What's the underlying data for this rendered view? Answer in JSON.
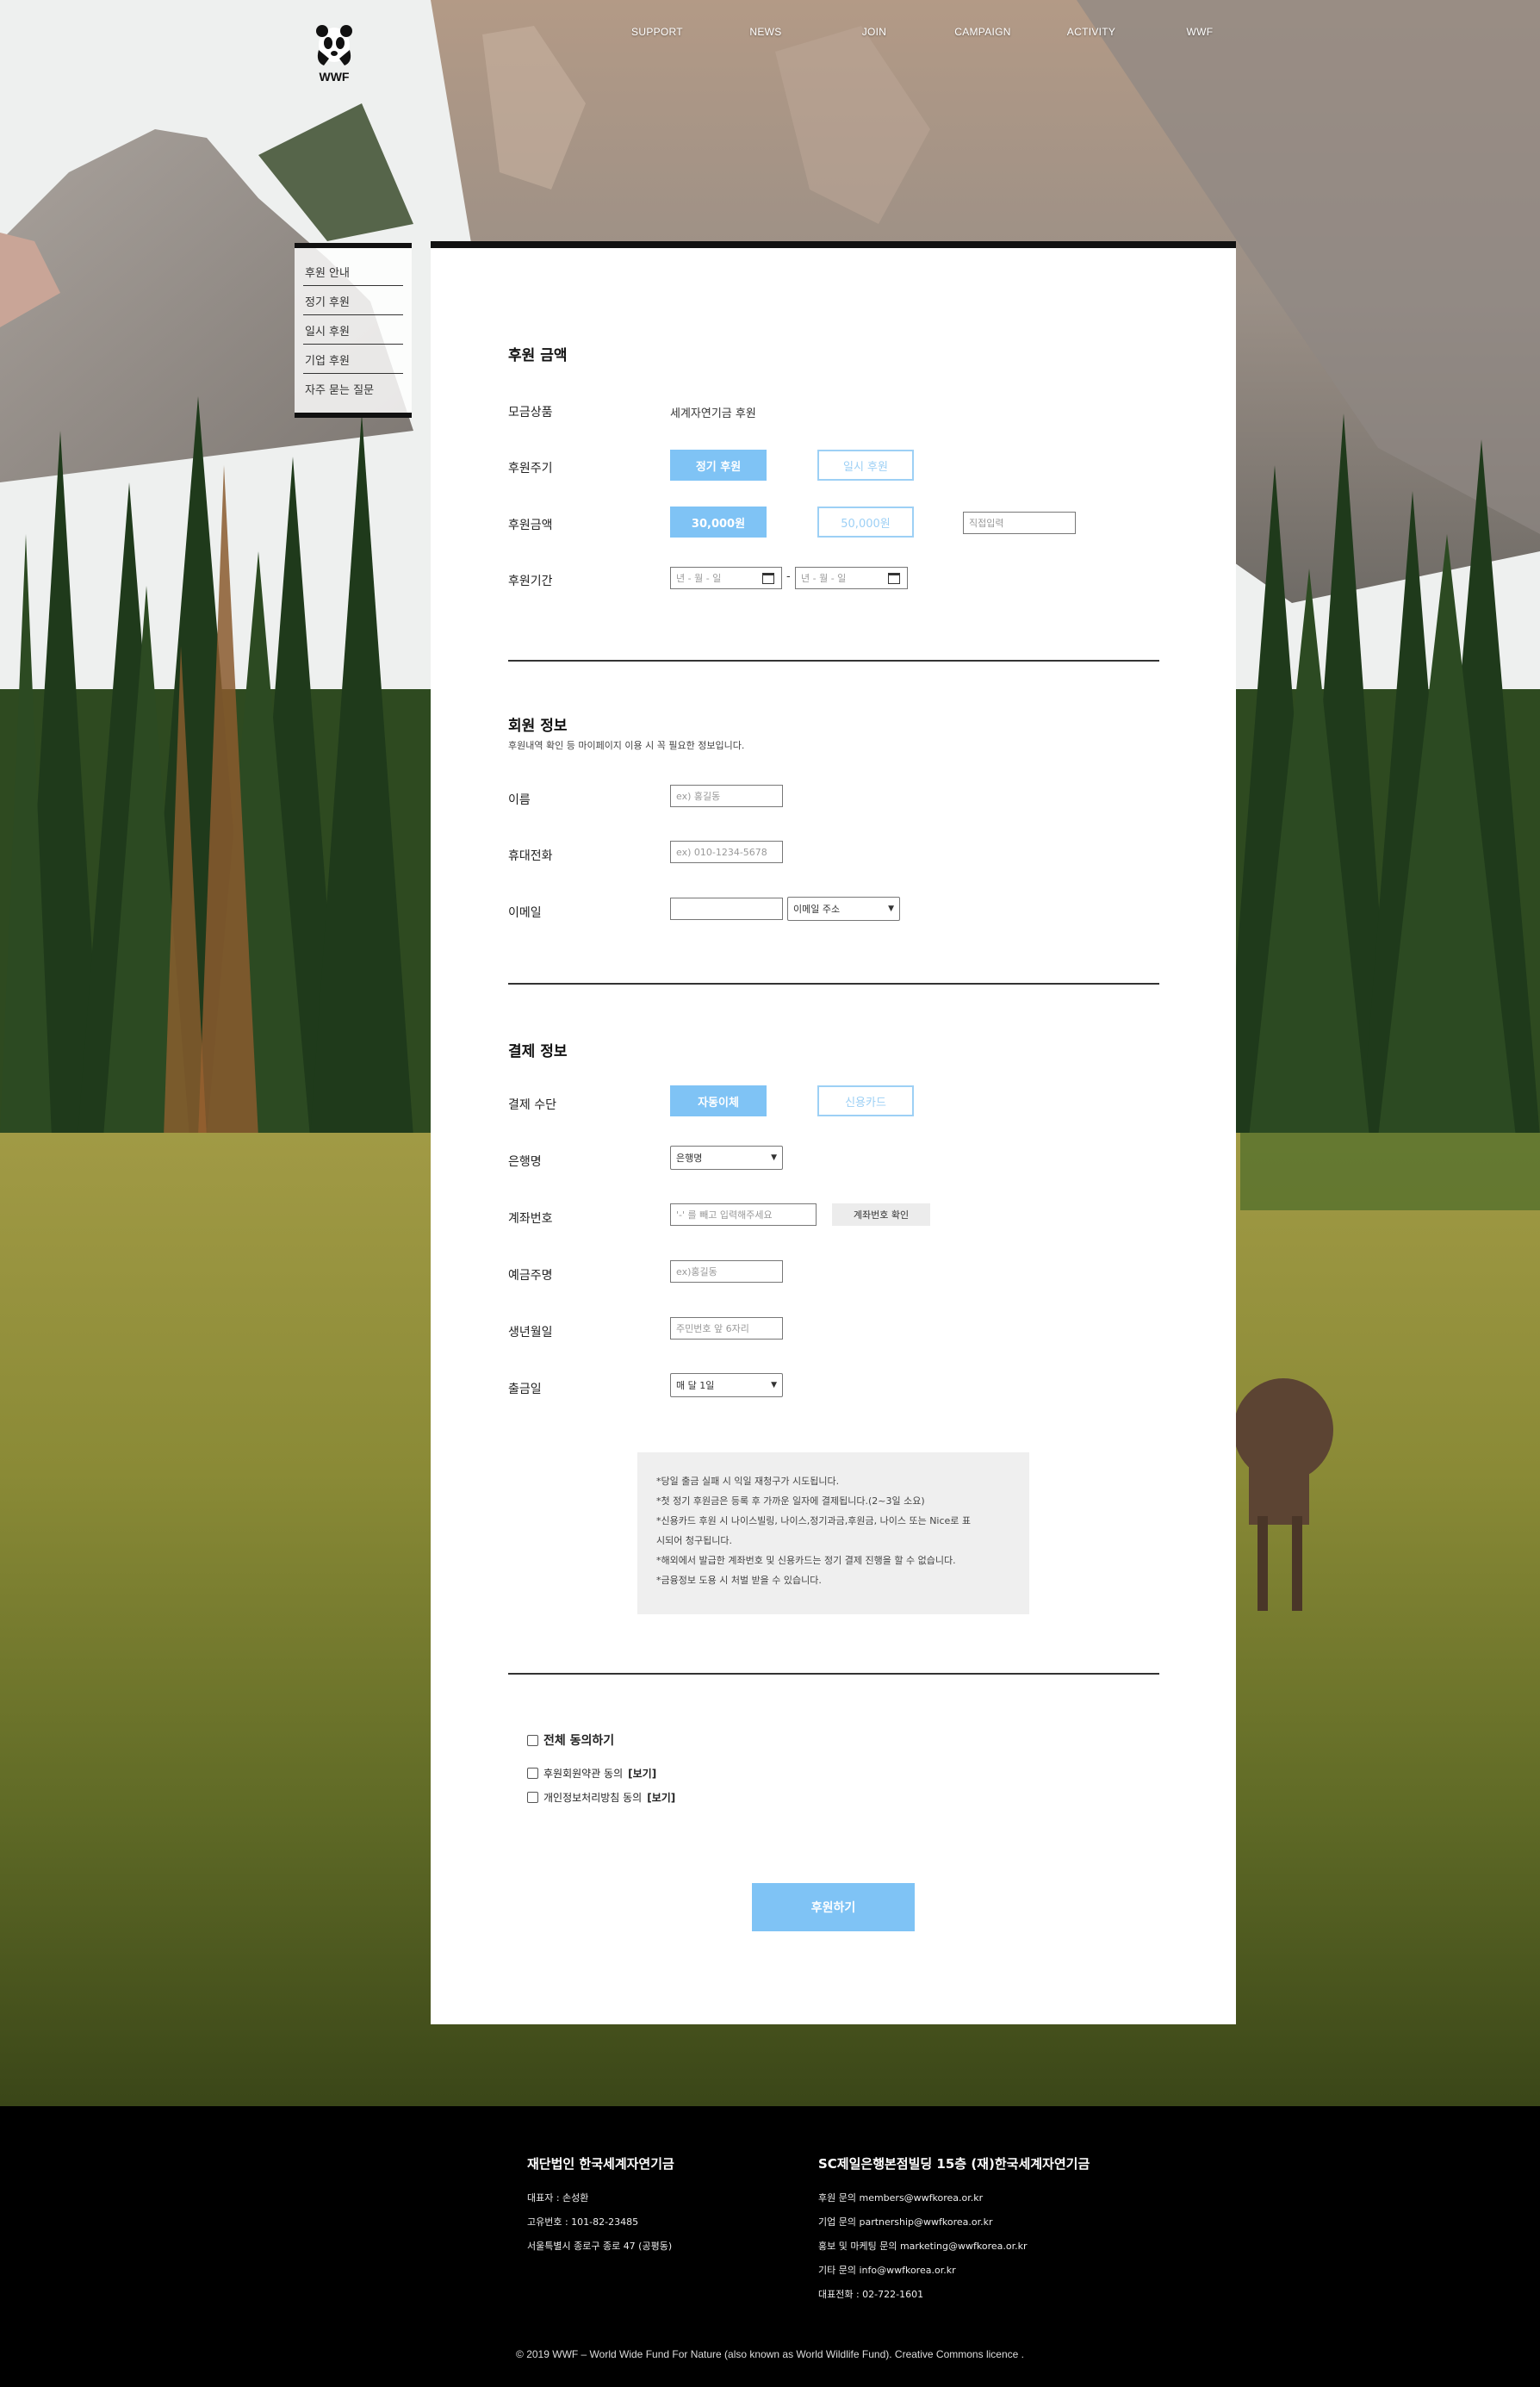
{
  "nav": {
    "items": [
      "SUPPORT",
      "NEWS",
      "JOIN",
      "CAMPAIGN",
      "ACTIVITY",
      "WWF"
    ]
  },
  "logo": {
    "text": "WWF"
  },
  "sidemenu": {
    "items": [
      "후원 안내",
      "정기 후원",
      "일시 후원",
      "기업 후원",
      "자주 묻는 질문"
    ]
  },
  "donation": {
    "title": "후원 금액",
    "product_label": "모금상품",
    "product_value": "세계자연기금 후원",
    "cycle_label": "후원주기",
    "cycle_regular": "정기 후원",
    "cycle_once": "일시 후원",
    "amount_label": "후원금액",
    "amount_30000": "30,000원",
    "amount_50000": "50,000원",
    "amount_custom_placeholder": "직접입력",
    "period_label": "후원기간",
    "date_placeholder": "년 - 월 - 일",
    "date_sep": "-"
  },
  "member": {
    "title": "회원 정보",
    "subtitle": "후원내역 확인 등 마이페이지 이용 시 꼭 필요한 정보입니다.",
    "name_label": "이름",
    "name_placeholder": "ex) 홍길동",
    "phone_label": "휴대전화",
    "phone_placeholder": "ex) 010-1234-5678",
    "email_label": "이메일",
    "email_select": "이메일 주소"
  },
  "payment": {
    "title": "결제 정보",
    "method_label": "결제 수단",
    "method_auto": "자동이체",
    "method_card": "신용카드",
    "bank_label": "은행명",
    "bank_select": "은행명",
    "account_label": "계좌번호",
    "account_placeholder": "'-' 를 빼고 입력해주세요",
    "account_check": "계좌번호 확인",
    "holder_label": "예금주명",
    "holder_placeholder": "ex)홍길동",
    "birth_label": "생년월일",
    "birth_placeholder": "주민번호 앞 6자리",
    "day_label": "출금일",
    "day_select": "매 달 1일"
  },
  "notice": [
    "*당일 출금 실패 시 익일 재청구가 시도됩니다.",
    "*첫 정기 후원금은 등록 후 가까운 일자에 결제됩니다.(2~3일 소요)",
    "*신용카드 후원 시 나이스빌링, 나이스,정기과금,후원금, 나이스 또는 Nice로 표",
    "시되어 청구됩니다.",
    "*해외에서 발급한 계좌번호 및 신용카드는 정기 결제 진행을 할 수 없습니다.",
    "*금융정보 도용 시 처벌 받을 수 있습니다."
  ],
  "agree": {
    "all": "전체 동의하기",
    "terms": "후원회원약관 동의",
    "privacy": "개인정보처리방침 동의",
    "view": "[보기]"
  },
  "submit_label": "후원하기",
  "footer": {
    "left_title": "재단법인 한국세계자연기금",
    "left_lines": [
      "대표자 : 손성환",
      "고유번호 : 101-82-23485",
      "서울특별시 종로구 종로 47 (공평동)"
    ],
    "right_title": "SC제일은행본점빌딩 15층 (재)한국세계자연기금",
    "right_lines": [
      "후원 문의 members@wwfkorea.or.kr",
      "기업 문의 partnership@wwfkorea.or.kr",
      "홍보 및 마케팅 문의 marketing@wwfkorea.or.kr",
      "기타 문의 info@wwfkorea.or.kr",
      "대표전화 : 02-722-1601"
    ],
    "copyright": "© 2019 WWF – World Wide Fund For Nature (also known as World Wildlife Fund). Creative Commons licence ."
  },
  "colors": {
    "accent": "#7fc3f5",
    "accent_line": "#9dd0f5",
    "footer_bg": "#000000"
  }
}
